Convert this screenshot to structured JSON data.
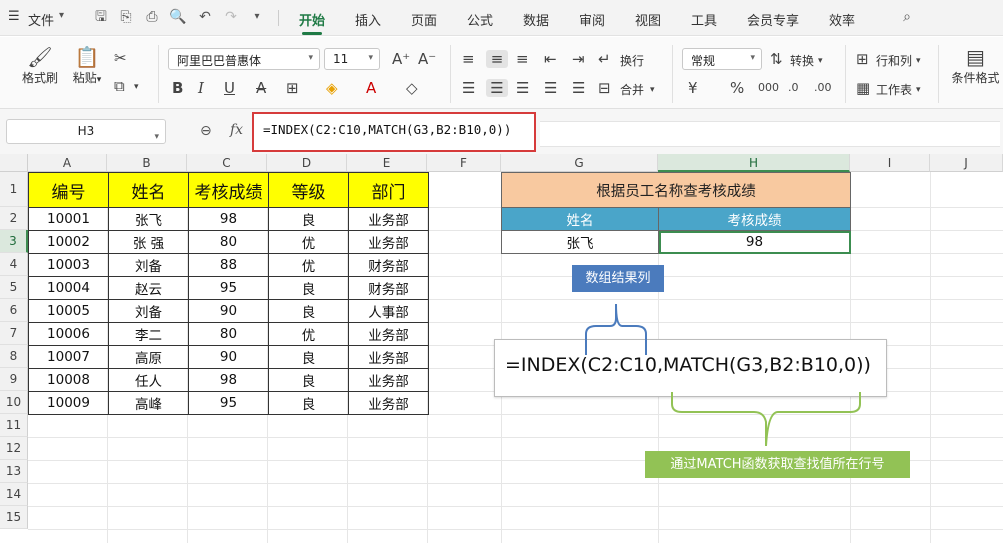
{
  "menubar": {
    "file_label": "文件",
    "tabs": [
      "开始",
      "插入",
      "页面",
      "公式",
      "数据",
      "审阅",
      "视图",
      "工具",
      "会员专享",
      "效率"
    ]
  },
  "ribbon": {
    "format_painter": "格式刷",
    "paste": "粘贴",
    "font_name": "阿里巴巴普惠体",
    "font_size": "11",
    "wrap": "换行",
    "merge": "合并",
    "number_format": "常规",
    "convert": "转换",
    "rows_cols": "行和列",
    "worksheet": "工作表",
    "conditional_format": "条件格式"
  },
  "formula_bar": {
    "cell_ref": "H3",
    "fx": "fx",
    "formula": "=INDEX(C2:C10,MATCH(G3,B2:B10,0))"
  },
  "grid": {
    "columns": [
      "A",
      "B",
      "C",
      "D",
      "E",
      "F",
      "G",
      "H",
      "I",
      "J"
    ],
    "rows": [
      "1",
      "2",
      "3",
      "4",
      "5",
      "6",
      "7",
      "8",
      "9",
      "10",
      "11",
      "12",
      "13",
      "14",
      "15"
    ]
  },
  "data_table": {
    "headers": [
      "编号",
      "姓名",
      "考核成绩",
      "等级",
      "部门"
    ],
    "rows": [
      [
        "10001",
        "张飞",
        "98",
        "良",
        "业务部"
      ],
      [
        "10002",
        "张 强",
        "80",
        "优",
        "业务部"
      ],
      [
        "10003",
        "刘备",
        "88",
        "优",
        "财务部"
      ],
      [
        "10004",
        "赵云",
        "95",
        "良",
        "财务部"
      ],
      [
        "10005",
        "刘备",
        "90",
        "良",
        "人事部"
      ],
      [
        "10006",
        "李二",
        "80",
        "优",
        "业务部"
      ],
      [
        "10007",
        "高原",
        "90",
        "良",
        "业务部"
      ],
      [
        "10008",
        "任人",
        "98",
        "良",
        "业务部"
      ],
      [
        "10009",
        "高峰",
        "95",
        "良",
        "业务部"
      ]
    ]
  },
  "lookup": {
    "title": "根据员工名称查考核成绩",
    "col_name": "姓名",
    "col_score": "考核成绩",
    "name_value": "张飞",
    "score_value": "98"
  },
  "annotations": {
    "array_result": "数组结果列",
    "formula_display": "=INDEX(C2:C10,MATCH(G3,B2:B10,0))",
    "match_note": "通过MATCH函数获取查找值所在行号"
  },
  "colors": {
    "accent": "#1f7a45",
    "header_yellow": "#ffff00",
    "lookup_title": "#f8c9a0",
    "lookup_sub": "#4aa5c9",
    "note_blue": "#4b7bbd",
    "note_green": "#92c255",
    "formula_border": "#d63b3b"
  }
}
